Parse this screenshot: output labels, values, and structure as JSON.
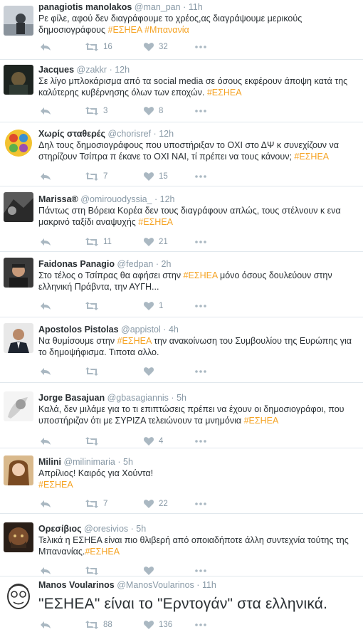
{
  "colors": {
    "hashtag": "#f5a323",
    "text": "#292f33",
    "muted": "#8899a6",
    "icon": "#aab8c2",
    "divider": "#e1e8ed"
  },
  "icons": {
    "reply": "reply-icon",
    "retweet": "retweet-icon",
    "like": "heart-icon",
    "more": "more-dots-icon"
  },
  "tweets": [
    {
      "name": "panagiotis manolakos",
      "handle": "@man_pan",
      "time": "11h",
      "text": "Ρε φίλε, αφού δεν διαγράφουμε το χρέος,ας διαγράψουμε μερικούς δημοσιογράφους ",
      "tags": [
        "#ΕΣΗΕΑ",
        "#Μπανανία"
      ],
      "retweets": "16",
      "likes": "32"
    },
    {
      "name": "Jacques",
      "handle": "@zakkr",
      "time": "12h",
      "text": "Σε λίγο μπλοκάρισμα από τα social media σε όσους εκφέρουν άποψη κατά της καλύτερης κυβέρνησης όλων των εποχών. ",
      "tags": [
        "#ΕΣΗΕΑ"
      ],
      "retweets": "3",
      "likes": "8"
    },
    {
      "name": "Χωρίς σταθερές",
      "handle": "@chorisref",
      "time": "12h",
      "text": "Δηλ τους δημοσιογράφους που υποστήριξαν το ΟΧΙ στο ΔΨ κ συνεχίζουν να στηρίζουν Τσίπρα π έκανε το ΟΧΙ ΝΑΙ, τί πρέπει να τους κάνουν; ",
      "tags": [
        "#ΕΣΗΕΑ"
      ],
      "retweets": "7",
      "likes": "15"
    },
    {
      "name": "Marissa®",
      "handle": "@omirouodyssia_",
      "time": "12h",
      "text": "Πάντως στη Βόρεια Κορέα δεν τους διαγράφουν απλώς, τους στέλνουν κ ενα μακρινό ταξίδι αναψυχής ",
      "tags": [
        "#ΕΣΗΕΑ"
      ],
      "retweets": "11",
      "likes": "21"
    },
    {
      "name": "Faidonas Panagio",
      "handle": "@fedpan",
      "time": "2h",
      "text_before": "Στο τέλος ο Τσίπρας θα αφήσει στην ",
      "tag_mid": "#ΕΣΗΕΑ",
      "text_after": " μόνο όσους δουλεύουν στην ελληνική Πράβντα, την ΑΥΓΗ...",
      "retweets": "",
      "likes": "1"
    },
    {
      "name": "Apostolos Pistolas",
      "handle": "@appistol",
      "time": "4h",
      "text_before": "Να θυμίσουμε στην ",
      "tag_mid": "#ΕΣΗΕΑ",
      "text_after": " την ανακοίνωση του Συμβουλίου της Ευρώπης για το δημοψήφισμα. Τιποτα αλλο.",
      "retweets": "",
      "likes": ""
    },
    {
      "name": "Jorge Basajuan",
      "handle": "@gbasagiannis",
      "time": "5h",
      "text": "Καλά, δεν μιλάμε για το τι επιπτώσεις πρέπει να έχουν οι δημοσιογράφοι, που υποστήριζαν ότι με ΣΥΡΙΖΑ τελειώνουν τα μνημόνια ",
      "tags": [
        "#ΕΣΗΕΑ"
      ],
      "retweets": "",
      "likes": "4"
    },
    {
      "name": "Milini",
      "handle": "@milinimaria",
      "time": "5h",
      "text_line1": "Απρίλιος! Καιρός για Χούντα!",
      "tags": [
        "#ΕΣΗΕΑ"
      ],
      "retweets": "7",
      "likes": "22"
    },
    {
      "name": "Ορεσίβιος",
      "handle": "@oresivios",
      "time": "5h",
      "text": "Τελικά η ΕΣΗΕΑ είναι πιο θλιβερή από οποιαδήποτε άλλη συντεχνία τούτης της Μπανανίας.",
      "tags": [
        "#ΕΣΗΕΑ"
      ],
      "retweets": "",
      "likes": ""
    },
    {
      "name": "Manos Voularinos",
      "handle": "@ManosVoularinos",
      "time": "11h",
      "text": "\"ΕΣΗΕΑ\" είναι το \"Ερντογάν\" στα ελληνικά.",
      "retweets": "88",
      "likes": "136"
    }
  ]
}
